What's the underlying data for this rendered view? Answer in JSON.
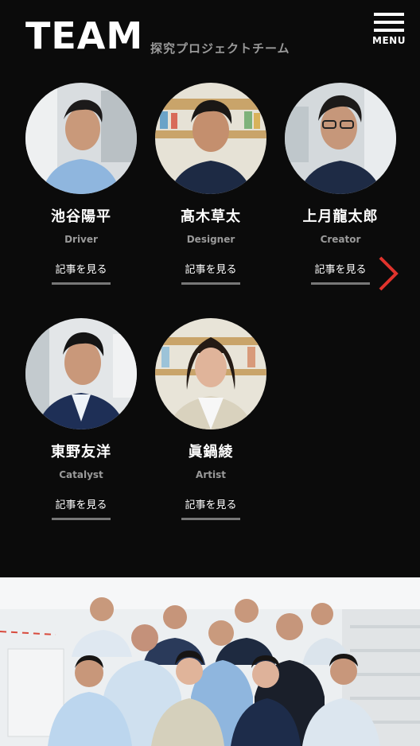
{
  "header": {
    "logo": "TEAM",
    "subtitle": "探究プロジェクトチーム",
    "menu_label": "MENU"
  },
  "members": [
    {
      "name": "池谷陽平",
      "role": "Driver",
      "link": "記事を見る"
    },
    {
      "name": "髙木草太",
      "role": "Designer",
      "link": "記事を見る"
    },
    {
      "name": "上月龍太郎",
      "role": "Creator",
      "link": "記事を見る"
    },
    {
      "name": "東野友洋",
      "role": "Catalyst",
      "link": "記事を見る"
    },
    {
      "name": "眞鍋綾",
      "role": "Artist",
      "link": "記事を見る"
    }
  ],
  "colors": {
    "background": "#0b0b0b",
    "accent_arrow": "#e0332c",
    "role_text": "#9a9a9a"
  },
  "icons": {
    "menu": "hamburger-icon",
    "next": "chevron-right-icon"
  }
}
